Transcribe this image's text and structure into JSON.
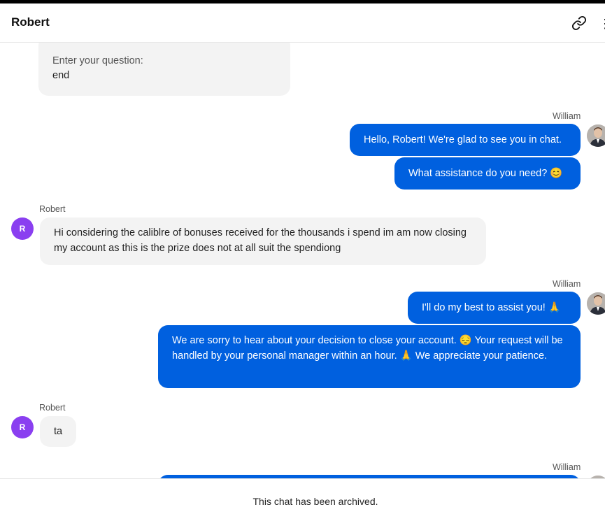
{
  "header": {
    "title": "Robert",
    "icons": [
      "link-icon",
      "more-icon"
    ]
  },
  "messages": [
    {
      "prompt_label": "Enter your question:",
      "prompt_value": "end"
    },
    {
      "sender": "William",
      "lines": [
        "Hello, Robert! We're glad to see you in chat.",
        "What assistance do you need? 😊"
      ]
    },
    {
      "sender": "Robert",
      "avatar_letter": "R",
      "text": "Hi considering the caliblre of bonuses received for the thousands i spend im am now closing my account as this is the prize does not at all suit the spendiong"
    },
    {
      "sender": "William",
      "lines": [
        "I'll do my best to assist you! 🙏",
        "We are sorry to hear about your decision to close your account. 😔 Your request will be handled by your personal manager within an hour. 🙏 We appreciate your patience."
      ]
    },
    {
      "sender": "Robert",
      "avatar_letter": "R",
      "text": "ta"
    },
    {
      "sender": "William"
    }
  ],
  "footer": {
    "status": "This chat has been archived."
  },
  "colors": {
    "outgoing": "#0060df",
    "incoming": "#f3f3f3",
    "avatar_robert": "#8a3ff0"
  }
}
